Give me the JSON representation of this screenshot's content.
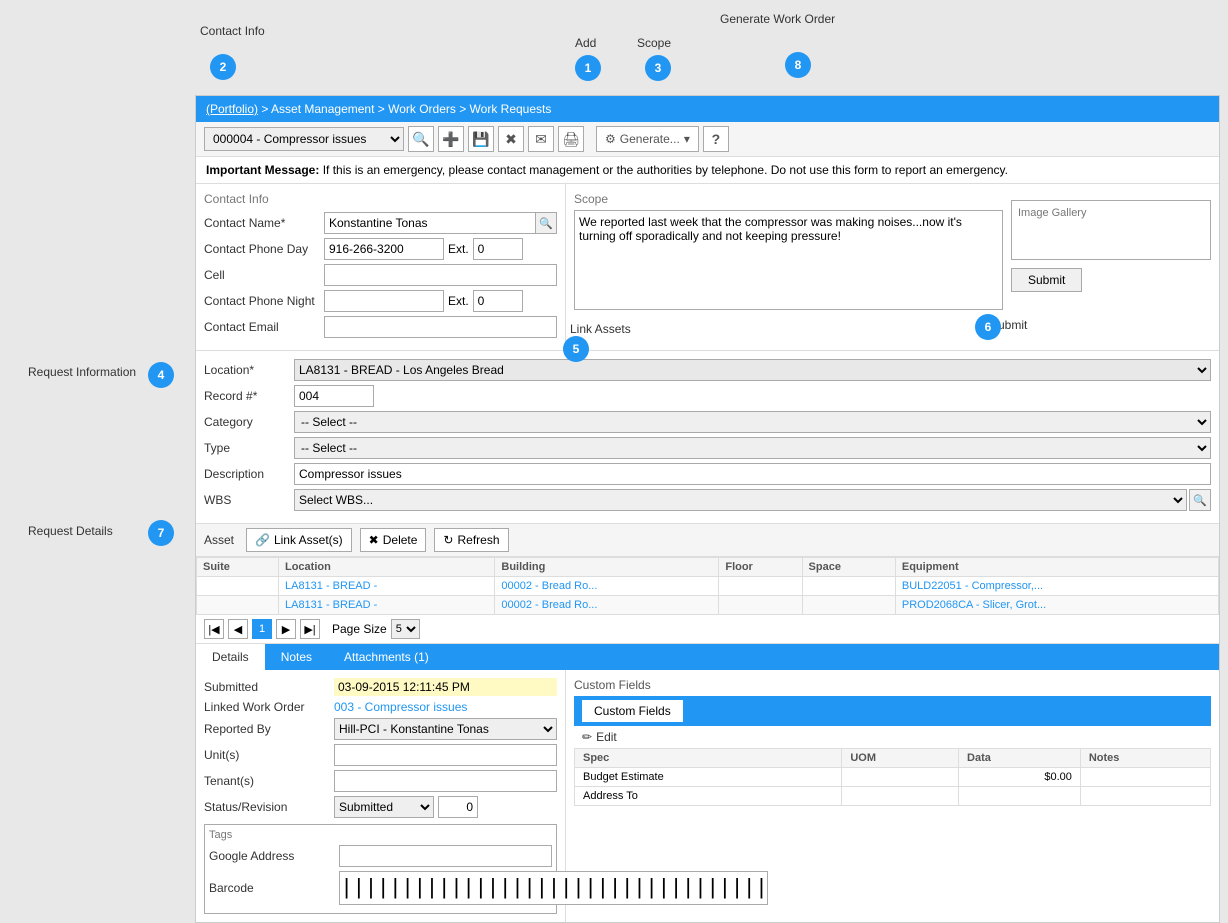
{
  "breadcrumb": {
    "portfolio": "(Portfolio)",
    "path": " > Asset Management > Work Orders > Work Requests"
  },
  "toolbar": {
    "record_value": "000004 - Compressor issues",
    "generate_label": "Generate...",
    "help_icon": "?"
  },
  "important_message": {
    "label": "Important Message:",
    "text": " If this is an emergency, please contact management or the authorities by telephone. Do not use this form to report an emergency."
  },
  "contact_info": {
    "title": "Contact Info",
    "contact_name_label": "Contact Name*",
    "contact_name_value": "Konstantine Tonas",
    "contact_phone_day_label": "Contact Phone Day",
    "contact_phone_day_value": "916-266-3200",
    "ext_label": "Ext.",
    "ext_day_value": "0",
    "cell_label": "Cell",
    "contact_phone_night_label": "Contact Phone Night",
    "ext_night_value": "0",
    "contact_email_label": "Contact Email"
  },
  "scope": {
    "label": "Scope",
    "text": "We reported last week that the compressor was making noises...now it's turning off sporadically and not keeping pressure!"
  },
  "image_gallery": {
    "title": "Image Gallery"
  },
  "submit_btn": "Submit",
  "request_info": {
    "outer_label": "Request Information",
    "location_label": "Location*",
    "location_value": "LA8131 - BREAD - Los Angeles Bread",
    "record_label": "Record #*",
    "record_value": "004",
    "category_label": "Category",
    "category_value": "-- Select --",
    "type_label": "Type",
    "type_value": "-- Select --",
    "description_label": "Description",
    "description_value": "Compressor issues",
    "wbs_label": "WBS",
    "wbs_placeholder": "Select WBS..."
  },
  "asset_section": {
    "label": "Asset",
    "link_asset_btn": "Link Asset(s)",
    "delete_btn": "Delete",
    "refresh_btn": "Refresh",
    "columns": [
      "Suite",
      "Location",
      "Building",
      "Floor",
      "Space",
      "Equipment"
    ],
    "rows": [
      {
        "suite": "",
        "location": "LA8131 - BREAD -",
        "building": "00002 - Bread Ro...",
        "floor": "",
        "space": "",
        "equipment": "BULD22051 - Compressor,..."
      },
      {
        "suite": "",
        "location": "LA8131 - BREAD -",
        "building": "00002 - Bread Ro...",
        "floor": "",
        "space": "",
        "equipment": "PROD2068CA - Slicer, Grot..."
      }
    ],
    "page_size_label": "Page Size",
    "page_size_value": "5",
    "current_page": "1"
  },
  "request_details": {
    "outer_label": "Request Details",
    "tabs": [
      "Details",
      "Notes",
      "Attachments (1)"
    ],
    "active_tab": "Details",
    "submitted_label": "Submitted",
    "submitted_value": "03-09-2015 12:11:45 PM",
    "linked_wo_label": "Linked Work Order",
    "linked_wo_value": "003 - Compressor issues",
    "reported_by_label": "Reported By",
    "reported_by_value": "Hill-PCI - Konstantine Tonas",
    "units_label": "Unit(s)",
    "tenants_label": "Tenant(s)",
    "status_label": "Status/Revision",
    "status_value": "Submitted",
    "revision_value": "0",
    "tags_label": "Tags",
    "google_address_label": "Google Address",
    "barcode_label": "Barcode"
  },
  "custom_fields": {
    "section_label": "Custom Fields",
    "tab_label": "Custom Fields",
    "edit_btn": "Edit",
    "columns": [
      "Spec",
      "UOM",
      "Data",
      "Notes"
    ],
    "rows": [
      {
        "spec": "Budget Estimate",
        "uom": "",
        "data": "$0.00",
        "notes": ""
      },
      {
        "spec": "Address To",
        "uom": "",
        "data": "",
        "notes": ""
      }
    ]
  },
  "callouts": {
    "add": {
      "number": "1",
      "label": "Add"
    },
    "contact_info": {
      "number": "2",
      "label": "Contact Info"
    },
    "scope": {
      "number": "3",
      "label": "Scope"
    },
    "request_info": {
      "number": "4",
      "label": "Request Information"
    },
    "link_assets": {
      "number": "5",
      "label": "Link Assets"
    },
    "submit": {
      "number": "6",
      "label": "Submit"
    },
    "request_details": {
      "number": "7",
      "label": "Request Details"
    },
    "generate": {
      "number": "8",
      "label": "Generate Work Order"
    }
  }
}
